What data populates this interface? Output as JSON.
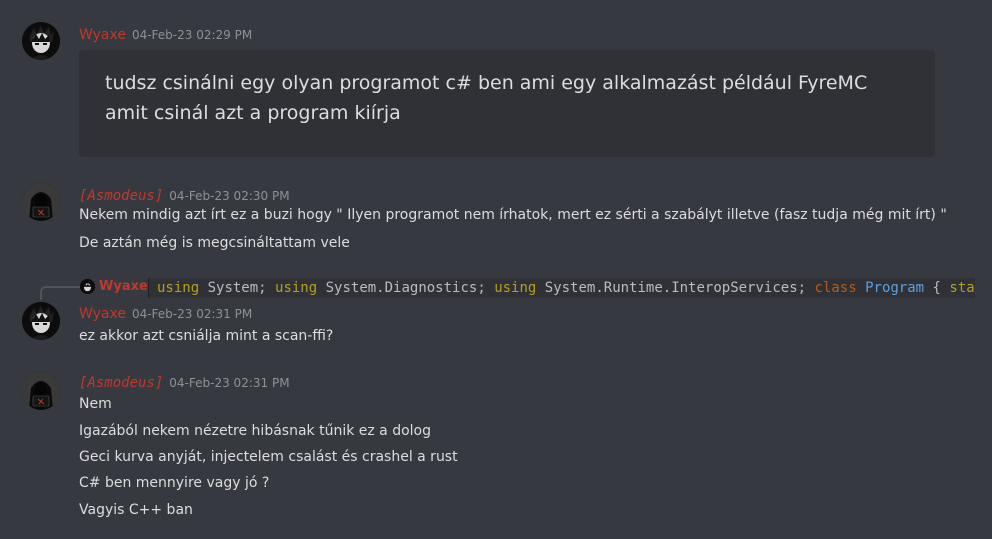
{
  "messages": [
    {
      "author": "Wyaxe",
      "timestamp": "04-Feb-23 02:29 PM",
      "embed_text": "tudsz csinálni egy olyan programot c# ben ami egy alkalmazást például FyreMC amit csinál azt a program kiírja"
    },
    {
      "author": "[Asmodeus]",
      "timestamp": "04-Feb-23 02:30 PM",
      "lines": [
        "Nekem mindig azt írt ez a buzi hogy \" Ilyen programot nem írhatok, mert ez sérti a szabályt illetve (fasz tudja még mit írt) \"",
        "De aztán még is megcsináltattam vele"
      ]
    },
    {
      "reply_to": {
        "author": "Wyaxe",
        "code": {
          "t1": "using",
          "t2": " System; ",
          "t3": "using",
          "t4": " System.Diagnostics; ",
          "t5": "using",
          "t6": " System.Runtime.InteropServices; ",
          "t7": "class",
          "t8": " ",
          "t9": "Program",
          "t10": " { ",
          "t11": "sta"
        }
      },
      "author": "Wyaxe",
      "timestamp": "04-Feb-23 02:31 PM",
      "lines": [
        "ez akkor azt csniálja mint a scan-ffi?"
      ]
    },
    {
      "author": "[Asmodeus]",
      "timestamp": "04-Feb-23 02:31 PM",
      "lines": [
        "Nem",
        "Igazából nekem nézetre hibásnak tűnik ez a dolog",
        "Geci kurva anyját, injectelem  csalást és crashel a rust",
        "C# ben mennyire vagy jó ?",
        "Vagyis C++ ban"
      ]
    }
  ],
  "colors": {
    "background": "#36393f",
    "embed_background": "#2f3136",
    "username_red": "#c0392b",
    "timestamp": "#8e9297",
    "text": "#dcddde"
  }
}
